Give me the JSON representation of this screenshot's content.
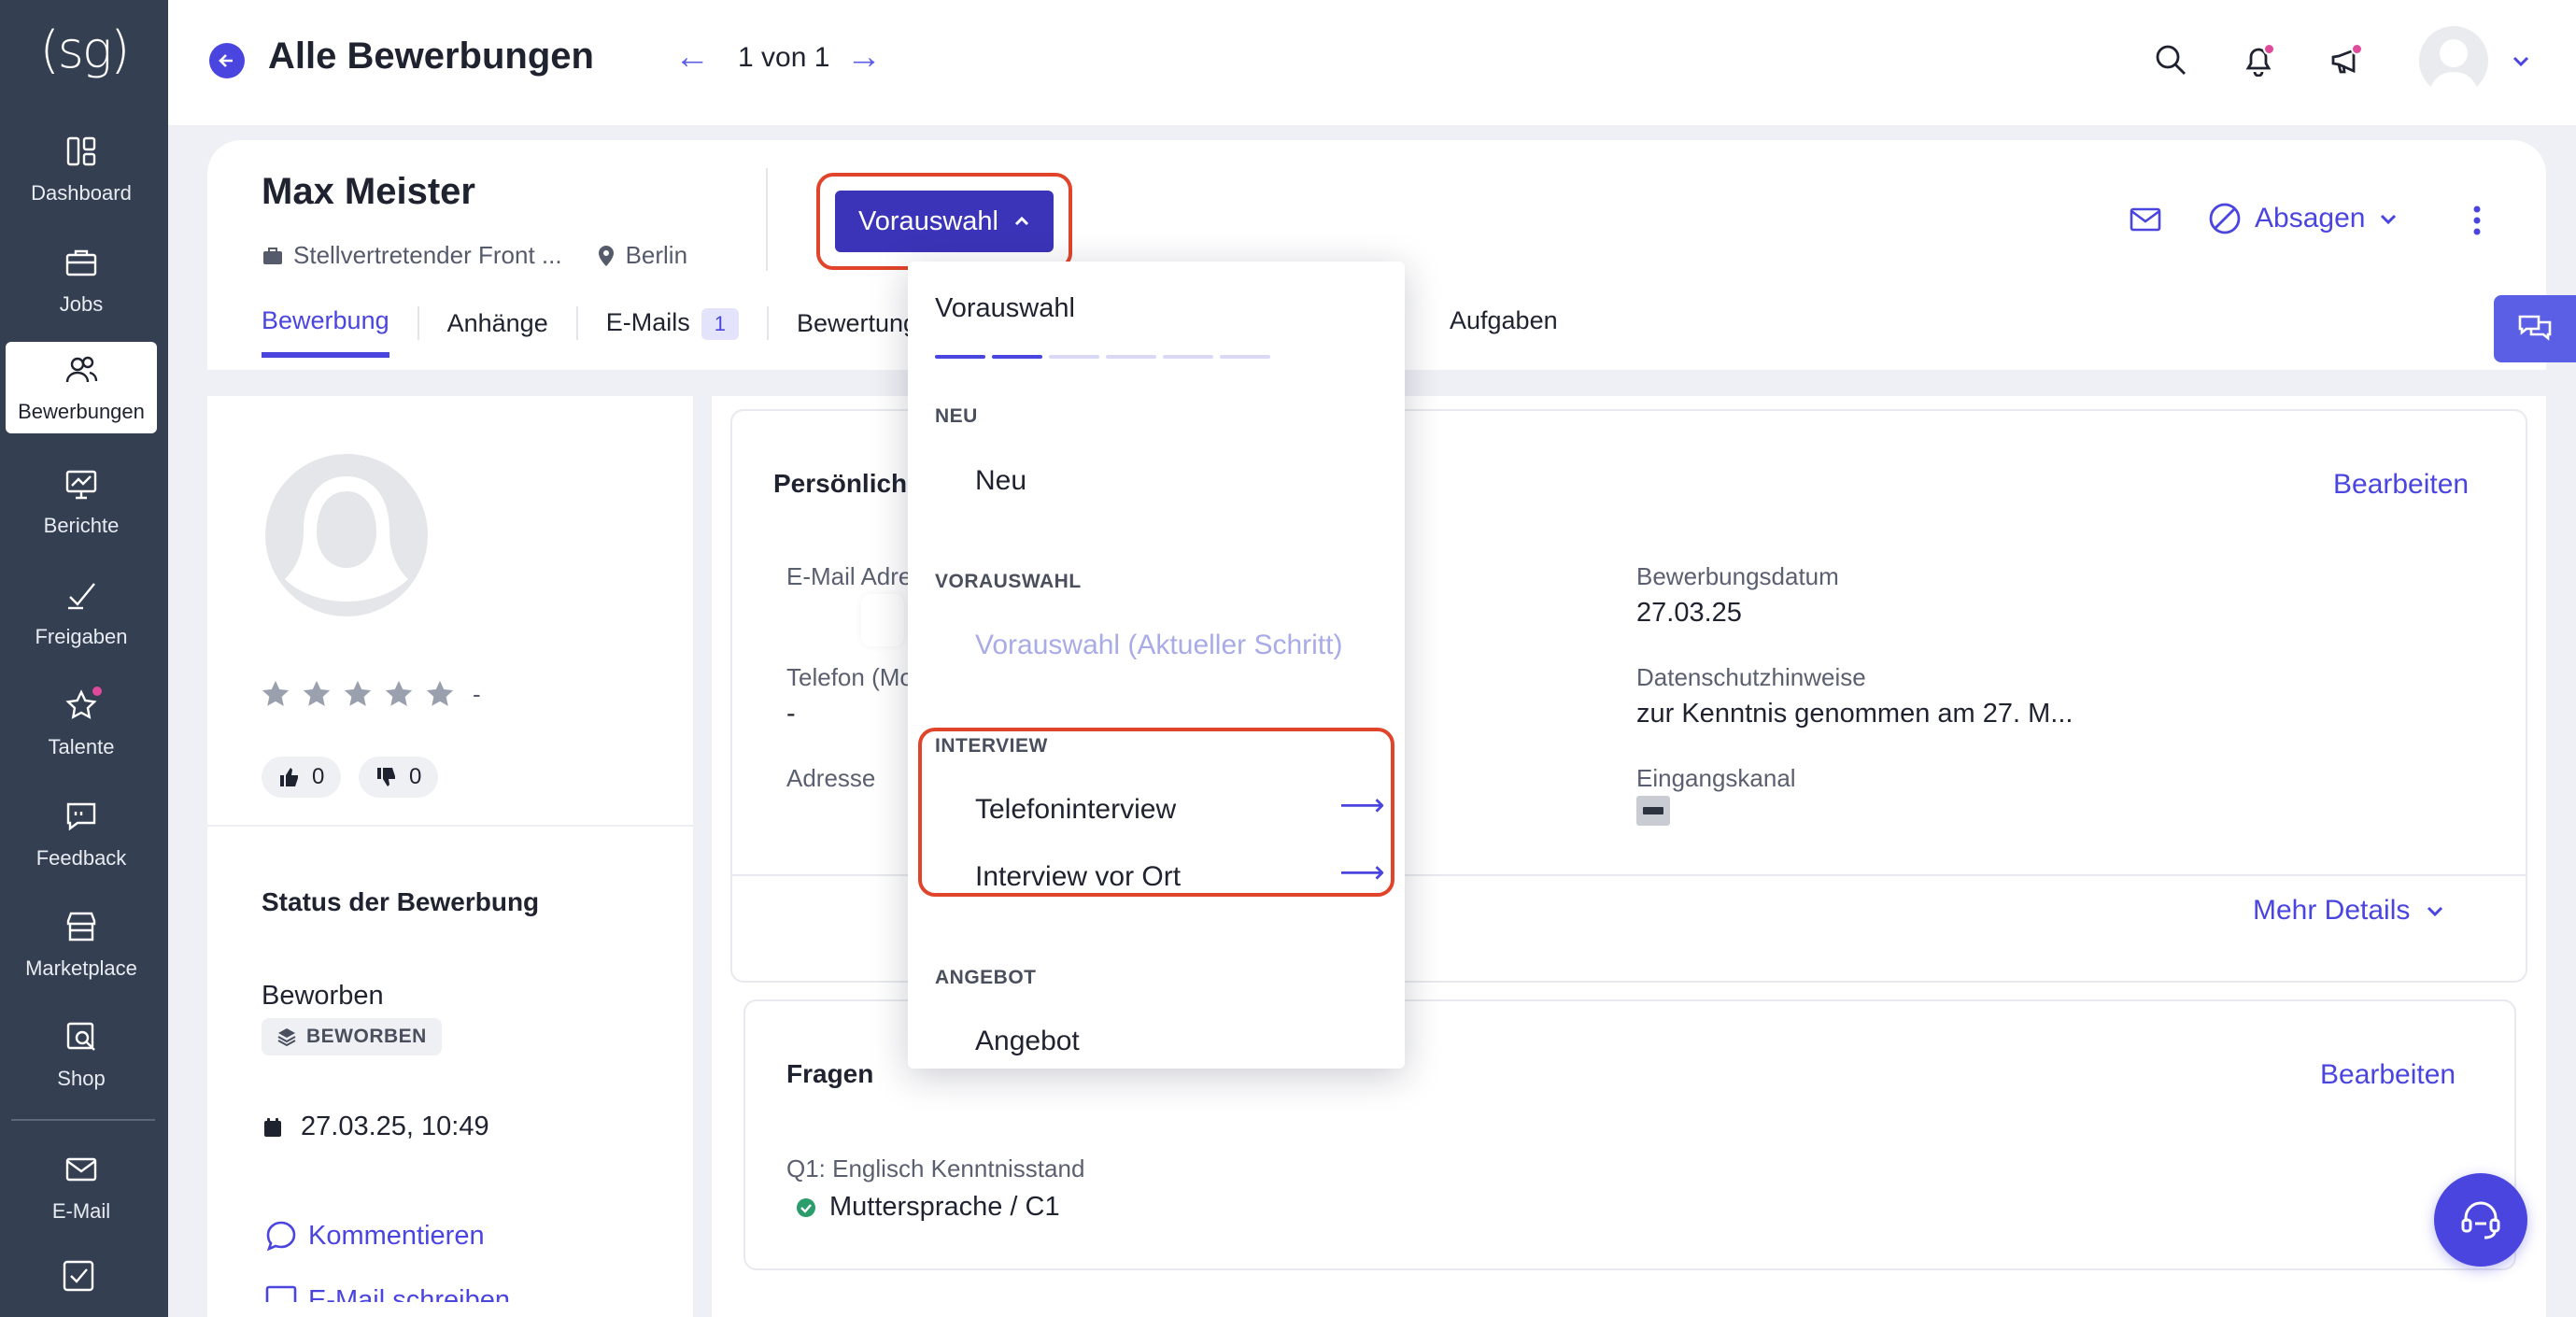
{
  "sidebar": {
    "logo": "(sg)",
    "items": [
      {
        "label": "Dashboard",
        "icon": "dashboard-icon"
      },
      {
        "label": "Jobs",
        "icon": "briefcase-icon"
      },
      {
        "label": "Bewerbungen",
        "icon": "users-icon",
        "active": true
      },
      {
        "label": "Berichte",
        "icon": "chart-icon"
      },
      {
        "label": "Freigaben",
        "icon": "approve-icon"
      },
      {
        "label": "Talente",
        "icon": "star-icon"
      },
      {
        "label": "Feedback",
        "icon": "feedback-icon"
      },
      {
        "label": "Marketplace",
        "icon": "store-icon"
      },
      {
        "label": "Shop",
        "icon": "shop-icon"
      },
      {
        "label": "E-Mail",
        "icon": "mail-icon"
      }
    ]
  },
  "header": {
    "title": "Alle Bewerbungen",
    "pager_prev": "←",
    "pager_text": "1 von 1",
    "pager_next": "→"
  },
  "candidate": {
    "name": "Max Meister",
    "job": "Stellvertretender Front ...",
    "location": "Berlin",
    "stage_button": "Vorauswahl",
    "reject_label": "Absagen"
  },
  "tabs": [
    {
      "label": "Bewerbung",
      "active": true
    },
    {
      "label": "Anhänge"
    },
    {
      "label": "E-Mails",
      "badge": "1"
    },
    {
      "label": "Bewertung"
    },
    {
      "label": "Aufgaben"
    }
  ],
  "left": {
    "rating_dash": "-",
    "thumbs_up": "0",
    "thumbs_down": "0",
    "status_heading": "Status der Bewerbung",
    "status_text": "Beworben",
    "status_chip": "BEWORBEN",
    "date": "27.03.25, 10:49",
    "comment_link": "Kommentieren",
    "email_link": "E-Mail schreiben"
  },
  "personal": {
    "heading": "Persönlich",
    "edit": "Bearbeiten",
    "email_label": "E-Mail Adre",
    "phone_label": "Telefon (Mo",
    "phone_value": "-",
    "address_label": "Adresse",
    "date_label": "Bewerbungsdatum",
    "date_value": "27.03.25",
    "privacy_label": "Datenschutzhinweise",
    "privacy_value": "zur Kenntnis genommen am 27. M...",
    "channel_label": "Eingangskanal",
    "more_details": "Mehr Details"
  },
  "questions": {
    "heading": "Fragen",
    "edit": "Bearbeiten",
    "q1_label": "Q1: Englisch Kenntnisstand",
    "q1_answer": "Muttersprache / C1"
  },
  "dropdown": {
    "title": "Vorauswahl",
    "progress_filled": 2,
    "progress_total": 6,
    "sections": [
      {
        "label": "NEU",
        "items": [
          "Neu"
        ]
      },
      {
        "label": "VORAUSWAHL",
        "items": [
          "Vorauswahl (Aktueller Schritt)"
        ]
      },
      {
        "label": "INTERVIEW",
        "items": [
          "Telefoninterview",
          "Interview vor Ort"
        ]
      },
      {
        "label": "ANGEBOT",
        "items": [
          "Angebot"
        ]
      }
    ],
    "arrow": "⟶"
  },
  "colors": {
    "accent": "#4b45e0",
    "sidebar_bg": "#343f52",
    "highlight": "#e0442b",
    "notification_dot": "#e04a9a"
  }
}
